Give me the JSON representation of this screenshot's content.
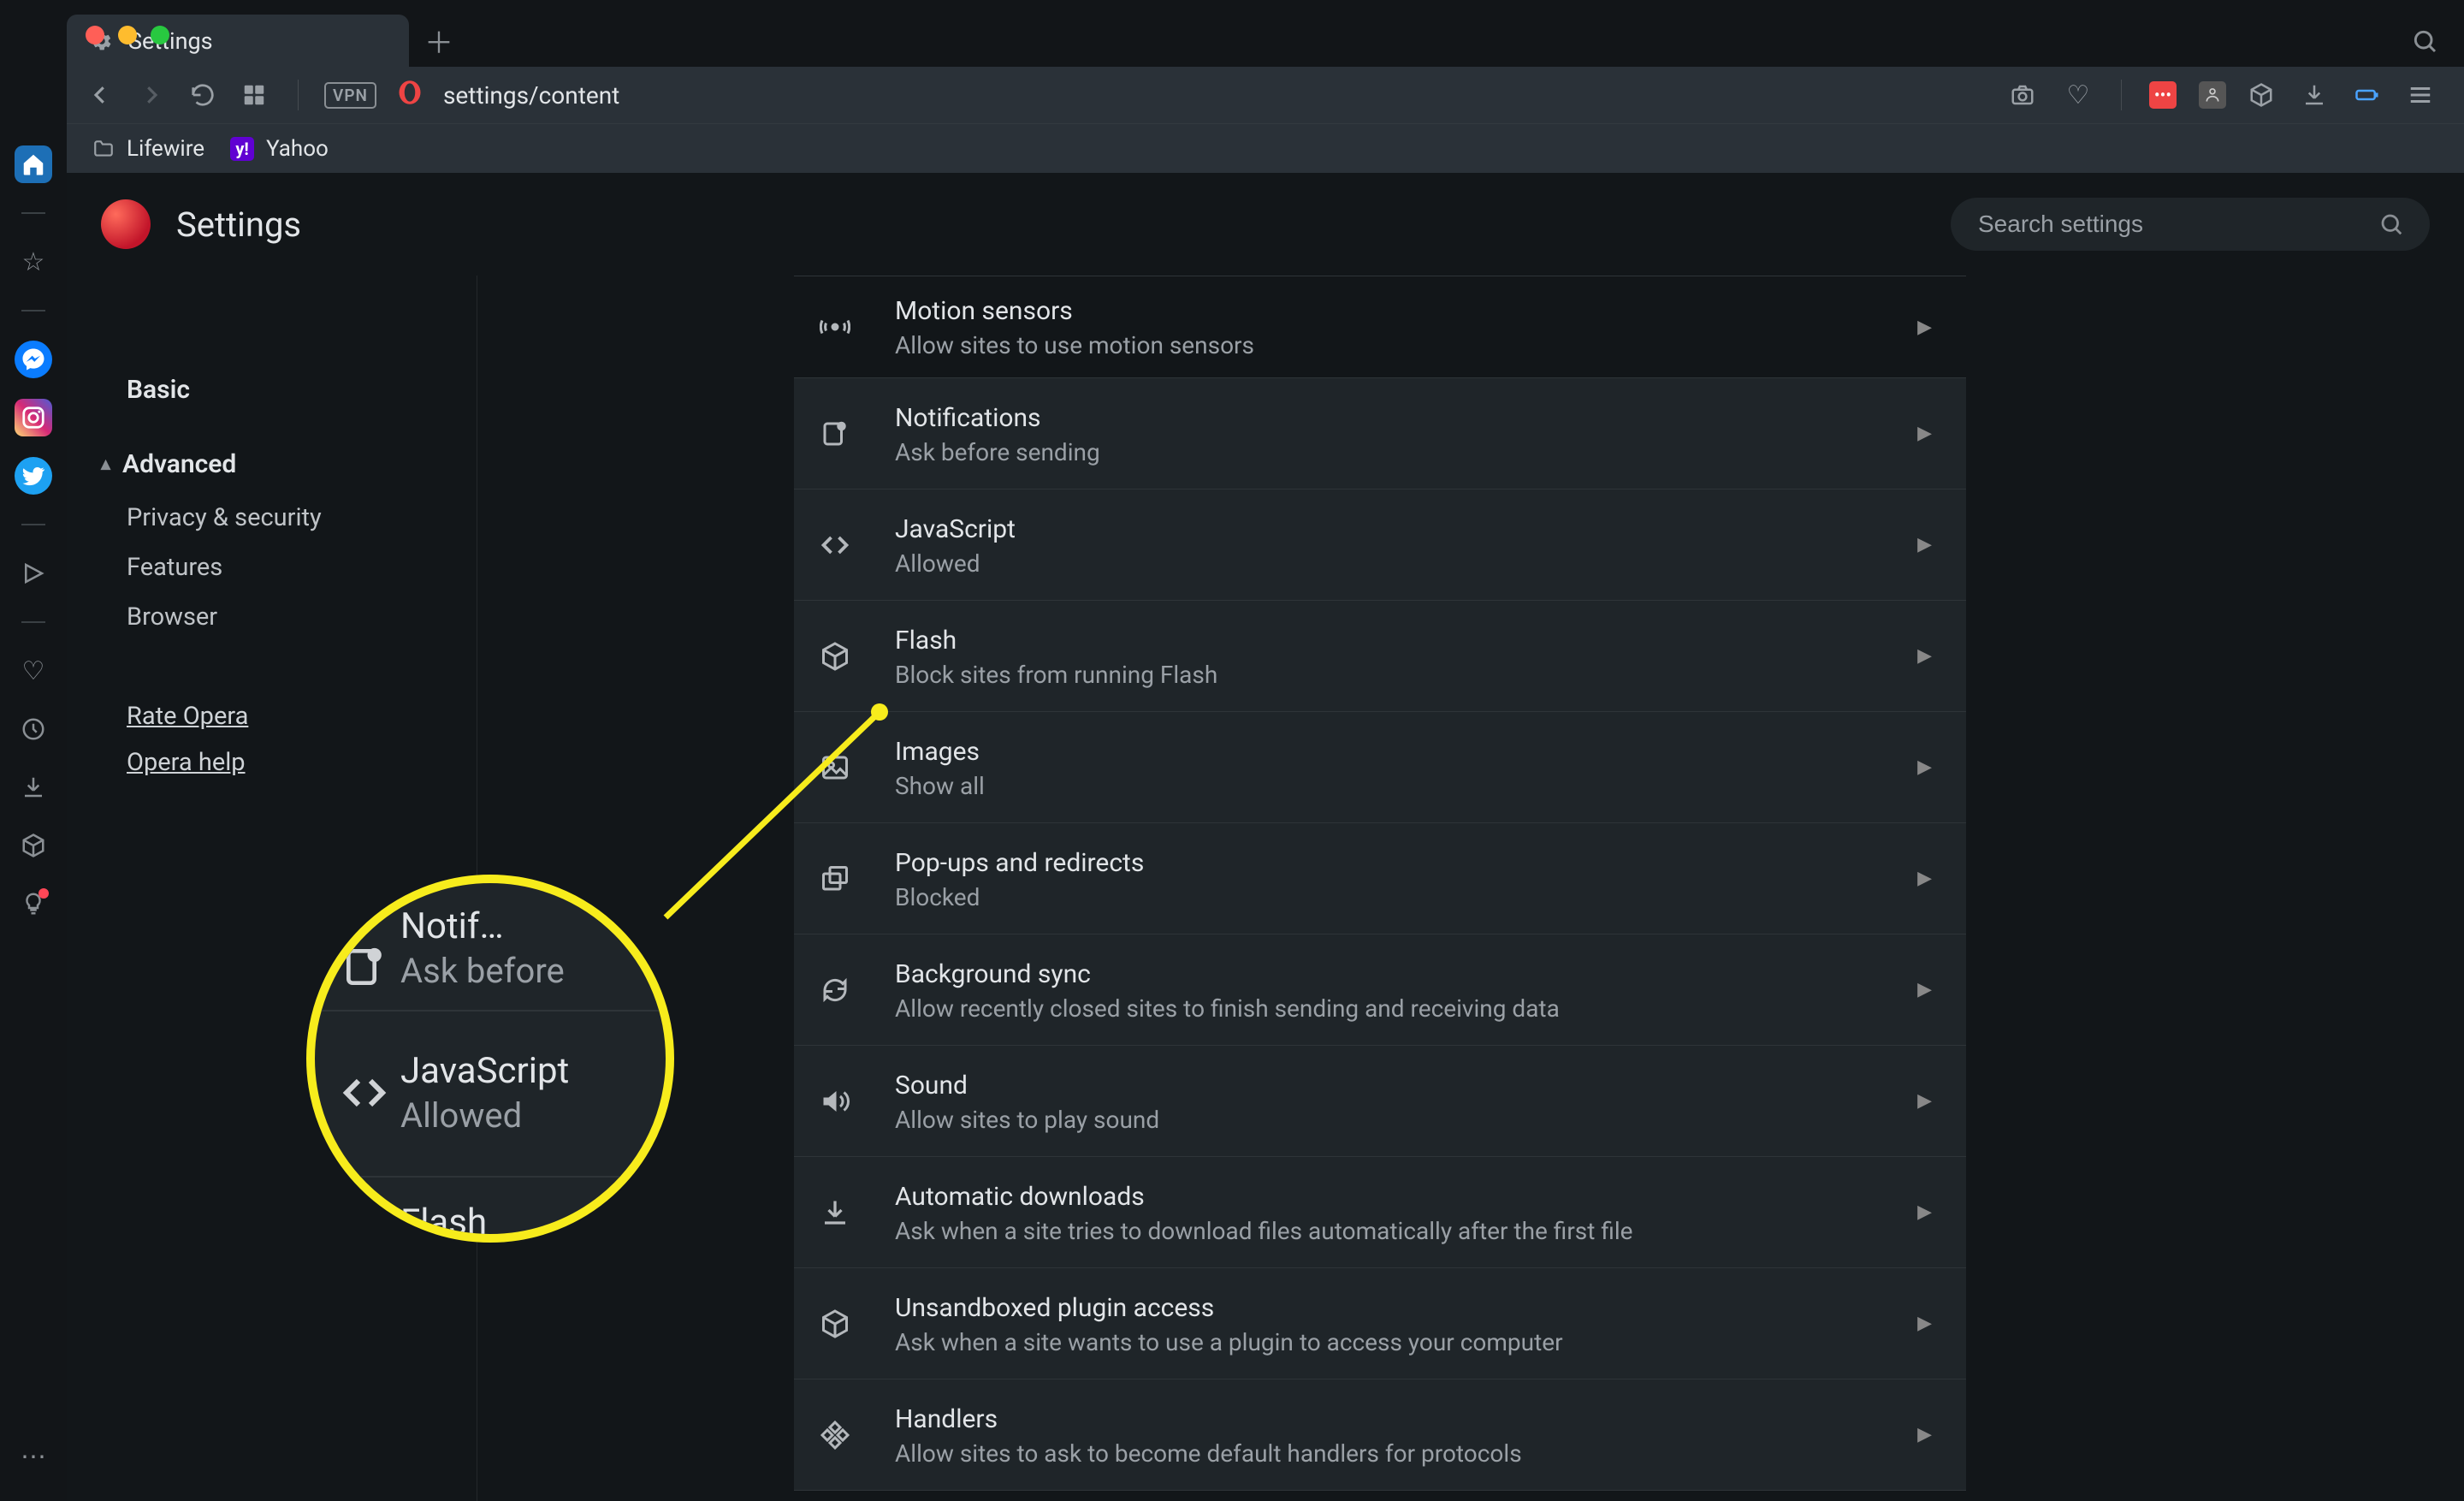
{
  "tab": {
    "title": "Settings"
  },
  "url": "settings/content",
  "bookmarks": [
    {
      "label": "Lifewire",
      "type": "folder"
    },
    {
      "label": "Yahoo",
      "type": "yahoo"
    }
  ],
  "page": {
    "title": "Settings",
    "search_placeholder": "Search settings"
  },
  "nav": {
    "basic": "Basic",
    "advanced": "Advanced",
    "subs": [
      "Privacy & security",
      "Features",
      "Browser"
    ],
    "links": [
      "Rate Opera",
      "Opera help"
    ]
  },
  "settings_rows": [
    {
      "icon": "sensors",
      "title": "Motion sensors",
      "sub": "Allow sites to use motion sensors"
    },
    {
      "icon": "notify",
      "title": "Notifications",
      "sub": "Ask before sending"
    },
    {
      "icon": "js",
      "title": "JavaScript",
      "sub": "Allowed"
    },
    {
      "icon": "flash",
      "title": "Flash",
      "sub": "Block sites from running Flash"
    },
    {
      "icon": "images",
      "title": "Images",
      "sub": "Show all"
    },
    {
      "icon": "popups",
      "title": "Pop-ups and redirects",
      "sub": "Blocked"
    },
    {
      "icon": "sync",
      "title": "Background sync",
      "sub": "Allow recently closed sites to finish sending and receiving data"
    },
    {
      "icon": "sound",
      "title": "Sound",
      "sub": "Allow sites to play sound"
    },
    {
      "icon": "download",
      "title": "Automatic downloads",
      "sub": "Ask when a site tries to download files automatically after the first file"
    },
    {
      "icon": "plugin",
      "title": "Unsandboxed plugin access",
      "sub": "Ask when a site wants to use a plugin to access your computer"
    },
    {
      "icon": "handlers",
      "title": "Handlers",
      "sub": "Allow sites to ask to become default handlers for protocols"
    }
  ],
  "magnifier": {
    "top": {
      "title": "Notif…",
      "sub": "Ask before"
    },
    "middle": {
      "title": "JavaScript",
      "sub": "Allowed"
    },
    "bottom": {
      "title": "Flash",
      "sub": ""
    }
  }
}
